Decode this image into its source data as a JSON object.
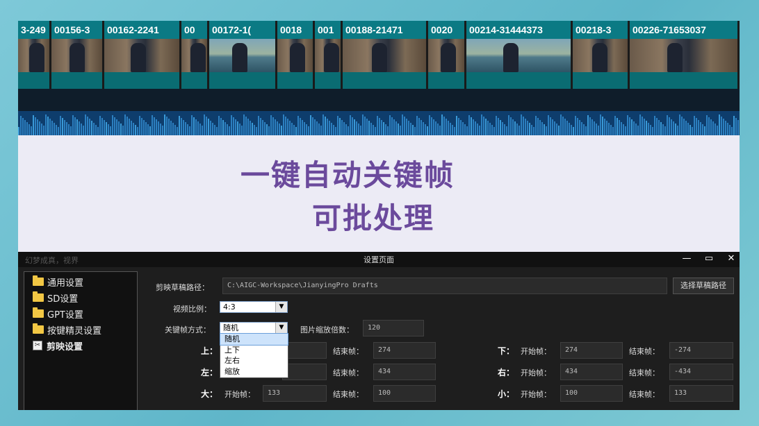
{
  "timeline": {
    "clips": [
      {
        "label": "3-249",
        "scene": "street"
      },
      {
        "label": "00156-3",
        "scene": "street"
      },
      {
        "label": "00162-2241",
        "scene": "street"
      },
      {
        "label": "00",
        "scene": "street"
      },
      {
        "label": "00172-1(",
        "scene": "river"
      },
      {
        "label": "0018",
        "scene": "street"
      },
      {
        "label": "001",
        "scene": "street"
      },
      {
        "label": "00188-21471",
        "scene": "street"
      },
      {
        "label": "0020",
        "scene": "street"
      },
      {
        "label": "00214-31444373",
        "scene": "river"
      },
      {
        "label": "00218-3",
        "scene": "street"
      },
      {
        "label": "00226-71653037",
        "scene": "street"
      }
    ]
  },
  "headline": {
    "line1": "一键自动关键帧",
    "line2": "可批处理",
    "color": "#6b4a9c"
  },
  "app": {
    "brand": "幻梦成真，视界",
    "window_title": "设置页面",
    "controls": {
      "minimize": "—",
      "maximize": "▭",
      "close": "✕"
    },
    "sidebar": {
      "items": [
        {
          "label": "通用设置",
          "icon": "folder-icon"
        },
        {
          "label": "SD设置",
          "icon": "folder-icon"
        },
        {
          "label": "GPT设置",
          "icon": "folder-icon"
        },
        {
          "label": "按键精灵设置",
          "icon": "folder-icon"
        },
        {
          "label": "剪映设置",
          "icon": "clip-settings-icon"
        }
      ]
    },
    "draft_path": {
      "label": "剪映草稿路径：",
      "value": "C:\\AIGC-Workspace\\JianyingPro Drafts",
      "button": "选择草稿路径"
    },
    "ratio": {
      "label": "视频比例：",
      "value": "4:3"
    },
    "keyframe_mode": {
      "label": "关键帧方式：",
      "value": "随机",
      "options": [
        "随机",
        "上下",
        "左右",
        "缩放"
      ]
    },
    "zoom": {
      "label": "图片缩放倍数：",
      "value": "120"
    },
    "rows": {
      "up": {
        "dir": "上：",
        "start_label": "开始帧：",
        "start": "",
        "end_label": "结束帧：",
        "end": "274"
      },
      "down": {
        "dir": "下：",
        "start_label": "开始帧：",
        "start": "274",
        "end_label": "结束帧：",
        "end": "-274"
      },
      "left": {
        "dir": "左：",
        "start_label": "开始帧：",
        "start": "",
        "end_label": "结束帧：",
        "end": "434"
      },
      "right": {
        "dir": "右：",
        "start_label": "开始帧：",
        "start": "434",
        "end_label": "结束帧：",
        "end": "-434"
      },
      "big": {
        "dir": "大：",
        "start_label": "开始帧：",
        "start": "133",
        "end_label": "结束帧：",
        "end": "100"
      },
      "small": {
        "dir": "小：",
        "start_label": "开始帧：",
        "start": "100",
        "end_label": "结束帧：",
        "end": "133"
      }
    }
  }
}
